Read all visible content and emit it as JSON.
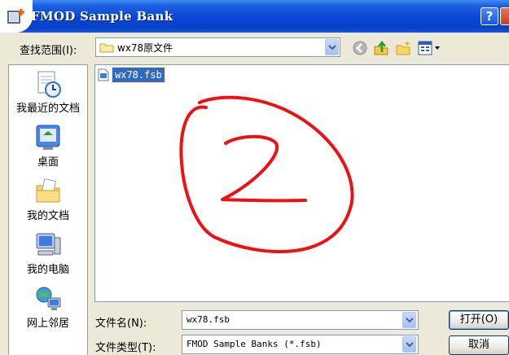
{
  "window": {
    "title": "FMOD Sample Bank"
  },
  "look_in": {
    "label": "查找范围(I):",
    "value": "wx78原文件"
  },
  "places": [
    {
      "label": "我最近的文档"
    },
    {
      "label": "桌面"
    },
    {
      "label": "我的文档"
    },
    {
      "label": "我的电脑"
    },
    {
      "label": "网上邻居"
    }
  ],
  "files": [
    {
      "name": "wx78.fsb"
    }
  ],
  "annotation": {
    "text": "2",
    "color": "#EE1111"
  },
  "file_name": {
    "label": "文件名(N):",
    "value": "wx78.fsb"
  },
  "file_type": {
    "label": "文件类型(T):",
    "value": "FMOD Sample Banks (*.fsb)"
  },
  "buttons": {
    "open": "打开(O)",
    "cancel": "取消",
    "help": "?"
  },
  "colors": {
    "titlebar": "#0A46D6",
    "selection": "#316AC5",
    "dialog_bg": "#ECE9D8"
  }
}
